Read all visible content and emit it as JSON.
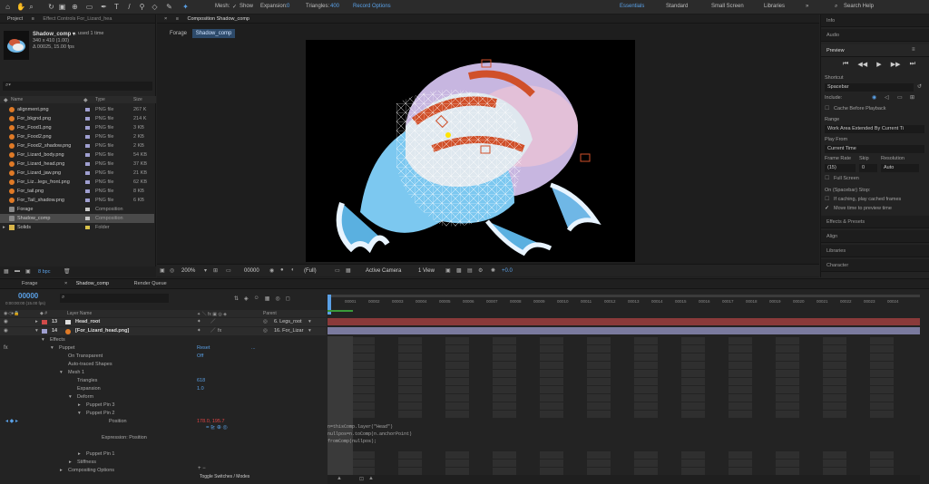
{
  "toolbar": {
    "mesh_label": "Mesh:",
    "show_label": "Show",
    "expansion_label": "Expansion:",
    "expansion_value": "0",
    "triangles_label": "Triangles:",
    "triangles_value": "400",
    "record_options": "Record Options",
    "workspaces": [
      "Essentials",
      "Standard",
      "Small Screen",
      "Libraries"
    ],
    "search_help": "Search Help"
  },
  "project": {
    "tab_project": "Project",
    "tab_effect_controls": "Effect Controls For_Lizard_hea",
    "selected_name": "Shadow_comp ▾",
    "used": ", used 1 time",
    "meta1": "340 x 410 (1.00)",
    "meta2": "Δ 00025, 15.00 fps",
    "search_placeholder": "⌕▾",
    "col_name": "Name",
    "col_type": "Type",
    "col_size": "Size",
    "items": [
      {
        "name": "alignment.png",
        "type": "PNG file",
        "size": "267 K",
        "kind": "png",
        "label_color": "#9f9fd0"
      },
      {
        "name": "For_bkgnd.png",
        "type": "PNG file",
        "size": "214 K",
        "kind": "png",
        "label_color": "#9f9fd0"
      },
      {
        "name": "For_Food1.png",
        "type": "PNG file",
        "size": "3 KB",
        "kind": "png",
        "label_color": "#9f9fd0"
      },
      {
        "name": "For_Food2.png",
        "type": "PNG file",
        "size": "2 KB",
        "kind": "png",
        "label_color": "#9f9fd0"
      },
      {
        "name": "For_Food2_shadow.png",
        "type": "PNG file",
        "size": "2 KB",
        "kind": "png",
        "label_color": "#9f9fd0"
      },
      {
        "name": "For_Lizard_body.png",
        "type": "PNG file",
        "size": "54 KB",
        "kind": "png",
        "label_color": "#9f9fd0"
      },
      {
        "name": "For_Lizard_head.png",
        "type": "PNG file",
        "size": "37 KB",
        "kind": "png",
        "label_color": "#9f9fd0"
      },
      {
        "name": "For_Lizard_jaw.png",
        "type": "PNG file",
        "size": "21 KB",
        "kind": "png",
        "label_color": "#9f9fd0"
      },
      {
        "name": "For_Liz...legs_front.png",
        "type": "PNG file",
        "size": "62 KB",
        "kind": "png",
        "label_color": "#9f9fd0"
      },
      {
        "name": "For_tail.png",
        "type": "PNG file",
        "size": "8 KB",
        "kind": "png",
        "label_color": "#9f9fd0"
      },
      {
        "name": "For_Tail_shadow.png",
        "type": "PNG file",
        "size": "6 KB",
        "kind": "png",
        "label_color": "#9f9fd0"
      },
      {
        "name": "Forage",
        "type": "Composition",
        "size": "",
        "kind": "comp",
        "label_color": "#c8c8c8"
      },
      {
        "name": "Shadow_comp",
        "type": "Composition",
        "size": "",
        "kind": "comp",
        "label_color": "#c8c8c8"
      },
      {
        "name": "Solids",
        "type": "Folder",
        "size": "",
        "kind": "folder",
        "label_color": "#d8c24a"
      }
    ],
    "bpc": "8 bpc"
  },
  "viewer": {
    "tab_label": "Composition Shadow_comp",
    "crumb_forage": "Forage",
    "crumb_shadow": "Shadow_comp",
    "zoom": "200%",
    "timecode": "00000",
    "resolution": "(Full)",
    "camera": "Active Camera",
    "views": "1 View",
    "exposure": "+0.0"
  },
  "right": {
    "info": "Info",
    "audio": "Audio",
    "preview": "Preview",
    "shortcut_label": "Shortcut",
    "shortcut_value": "Spacebar",
    "include_label": "Include:",
    "cache_before": "Cache Before Playback",
    "range_label": "Range",
    "range_value": "Work Area Extended By Current Ti",
    "play_from_label": "Play From",
    "play_from_value": "Current Time",
    "frame_rate_label": "Frame Rate",
    "skip_label": "Skip",
    "resolution_label": "Resolution",
    "frame_rate_value": "(15)",
    "skip_value": "0",
    "resolution_value": "Auto",
    "full_screen": "Full Screen",
    "on_stop": "On (Spacebar) Stop:",
    "if_caching": "If caching, play cached frames",
    "move_time": "Move time to preview time",
    "effects_presets": "Effects & Presets",
    "align": "Align",
    "libraries": "Libraries",
    "character": "Character"
  },
  "timeline": {
    "tab_forage": "Forage",
    "tab_shadow": "Shadow_comp",
    "tab_render": "Render Queue",
    "timecode": "00000",
    "timecode_sub": "0:00:00:00 (15.00 fps)",
    "col_layer_name": "Layer Name",
    "col_parent": "Parent",
    "layers": [
      {
        "num": "13",
        "name": "Head_root",
        "parent": "6. Legs_root",
        "color": "#d04a4a"
      },
      {
        "num": "14",
        "name": "[For_Lizard_head.png]",
        "parent": "16. For_Lizar",
        "color": "#9f9fd0"
      }
    ],
    "props": [
      {
        "label": "Effects",
        "indent": 55,
        "value": ""
      },
      {
        "label": "Puppet",
        "indent": 65,
        "value": "Reset",
        "value2": "..."
      },
      {
        "label": "On Transparent",
        "indent": 75,
        "value": "Off"
      },
      {
        "label": "Auto-traced Shapes",
        "indent": 75,
        "value": ""
      },
      {
        "label": "Mesh 1",
        "indent": 75,
        "value": ""
      },
      {
        "label": "Triangles",
        "indent": 85,
        "value": "618"
      },
      {
        "label": "Expansion",
        "indent": 85,
        "value": "1.0"
      },
      {
        "label": "Deform",
        "indent": 85,
        "value": ""
      },
      {
        "label": "Puppet Pin 3",
        "indent": 95,
        "value": ""
      },
      {
        "label": "Puppet Pin 2",
        "indent": 95,
        "value": ""
      },
      {
        "label": "Position",
        "indent": 120,
        "value": "178.0, 195.7"
      },
      {
        "label": "",
        "indent": 0,
        "value": ""
      },
      {
        "label": "Expression: Position",
        "indent": 112,
        "value": ""
      },
      {
        "label": "",
        "indent": 0,
        "value": ""
      },
      {
        "label": "Puppet Pin 1",
        "indent": 95,
        "value": ""
      },
      {
        "label": "Stiffness",
        "indent": 85,
        "value": ""
      },
      {
        "label": "Compositing Options",
        "indent": 75,
        "value": ""
      }
    ],
    "expression_lines": [
      "n=thisComp.layer(\"Head\")",
      "nullpos=n.toComp(n.anchorPoint)",
      "fromComp(nullpos);"
    ],
    "ruler": [
      "00001",
      "00002",
      "00003",
      "00004",
      "00005",
      "00006",
      "00007",
      "00008",
      "00009",
      "00010",
      "00011",
      "00012",
      "00013",
      "00014",
      "00015",
      "00016",
      "00017",
      "00018",
      "00019",
      "00020",
      "00021",
      "00022",
      "00023",
      "00024"
    ],
    "toggle": "Toggle Switches / Modes"
  },
  "colors": {
    "accent": "#5aa0e6",
    "red_bar": "#8a3a3a",
    "lilac_bar": "#7a7a9e"
  }
}
